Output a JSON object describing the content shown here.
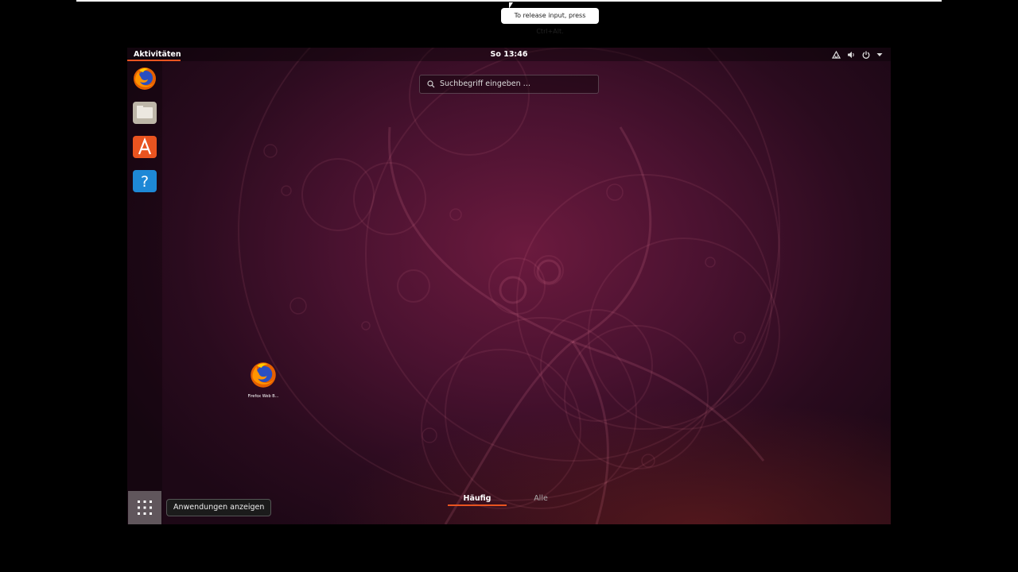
{
  "vm": {
    "release_hint": "To release input, press Ctrl+Alt."
  },
  "topbar": {
    "activities_label": "Aktivitäten",
    "clock": "So 13:46",
    "tray_icons": [
      "network-icon",
      "volume-icon",
      "power-icon",
      "chevron-down-icon"
    ]
  },
  "dock": {
    "items": [
      {
        "name": "Firefox",
        "icon": "firefox-icon"
      },
      {
        "name": "Dateien",
        "icon": "files-icon"
      },
      {
        "name": "Ubuntu Software",
        "icon": "software-center-icon"
      },
      {
        "name": "Hilfe",
        "icon": "help-icon",
        "glyph": "?"
      }
    ],
    "show_apps_tooltip": "Anwendungen anzeigen"
  },
  "search": {
    "placeholder": "Suchbegriff eingeben …"
  },
  "desktop": {
    "icon_label": "Firefox Web B..."
  },
  "app_tabs": {
    "frequent": "Häufig",
    "all": "Alle"
  },
  "colors": {
    "accent": "#e95420",
    "wallpaper_center": "#6b1a3e",
    "wallpaper_edge": "#1d0816"
  }
}
